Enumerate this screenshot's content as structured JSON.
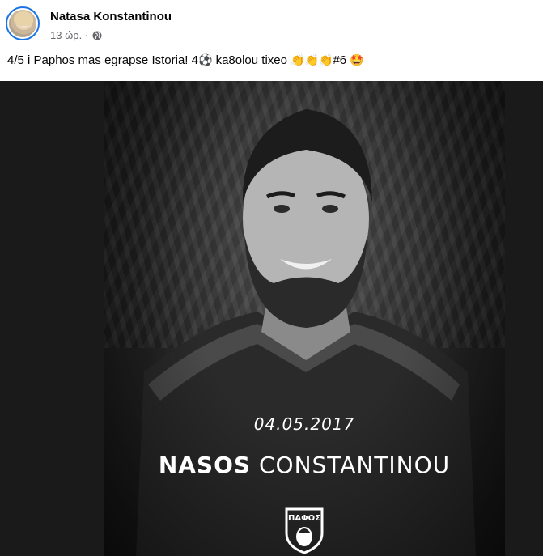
{
  "post": {
    "author": "Natasa Konstantinou",
    "time": "13 ώρ.",
    "separator": "·",
    "privacy_icon": "globe-icon",
    "text_main": "4/5 i Paphos mas egrapse Istoria! 4",
    "text_ball": "⚽",
    "text_mid": " ka8olou tixeo ",
    "text_clap": "👏👏👏",
    "text_tag": "#6 ",
    "text_face": "🤩"
  },
  "photo": {
    "date": "04.05.2017",
    "first_name": "NASOS",
    "last_name": "CONSTANTINOU",
    "crest_text": "ΠΑΦΟΣ"
  },
  "colors": {
    "name": "#050505",
    "meta": "#65676b",
    "avatar_ring": "#1b74e4",
    "photo_bg": "#1a1a1a"
  }
}
